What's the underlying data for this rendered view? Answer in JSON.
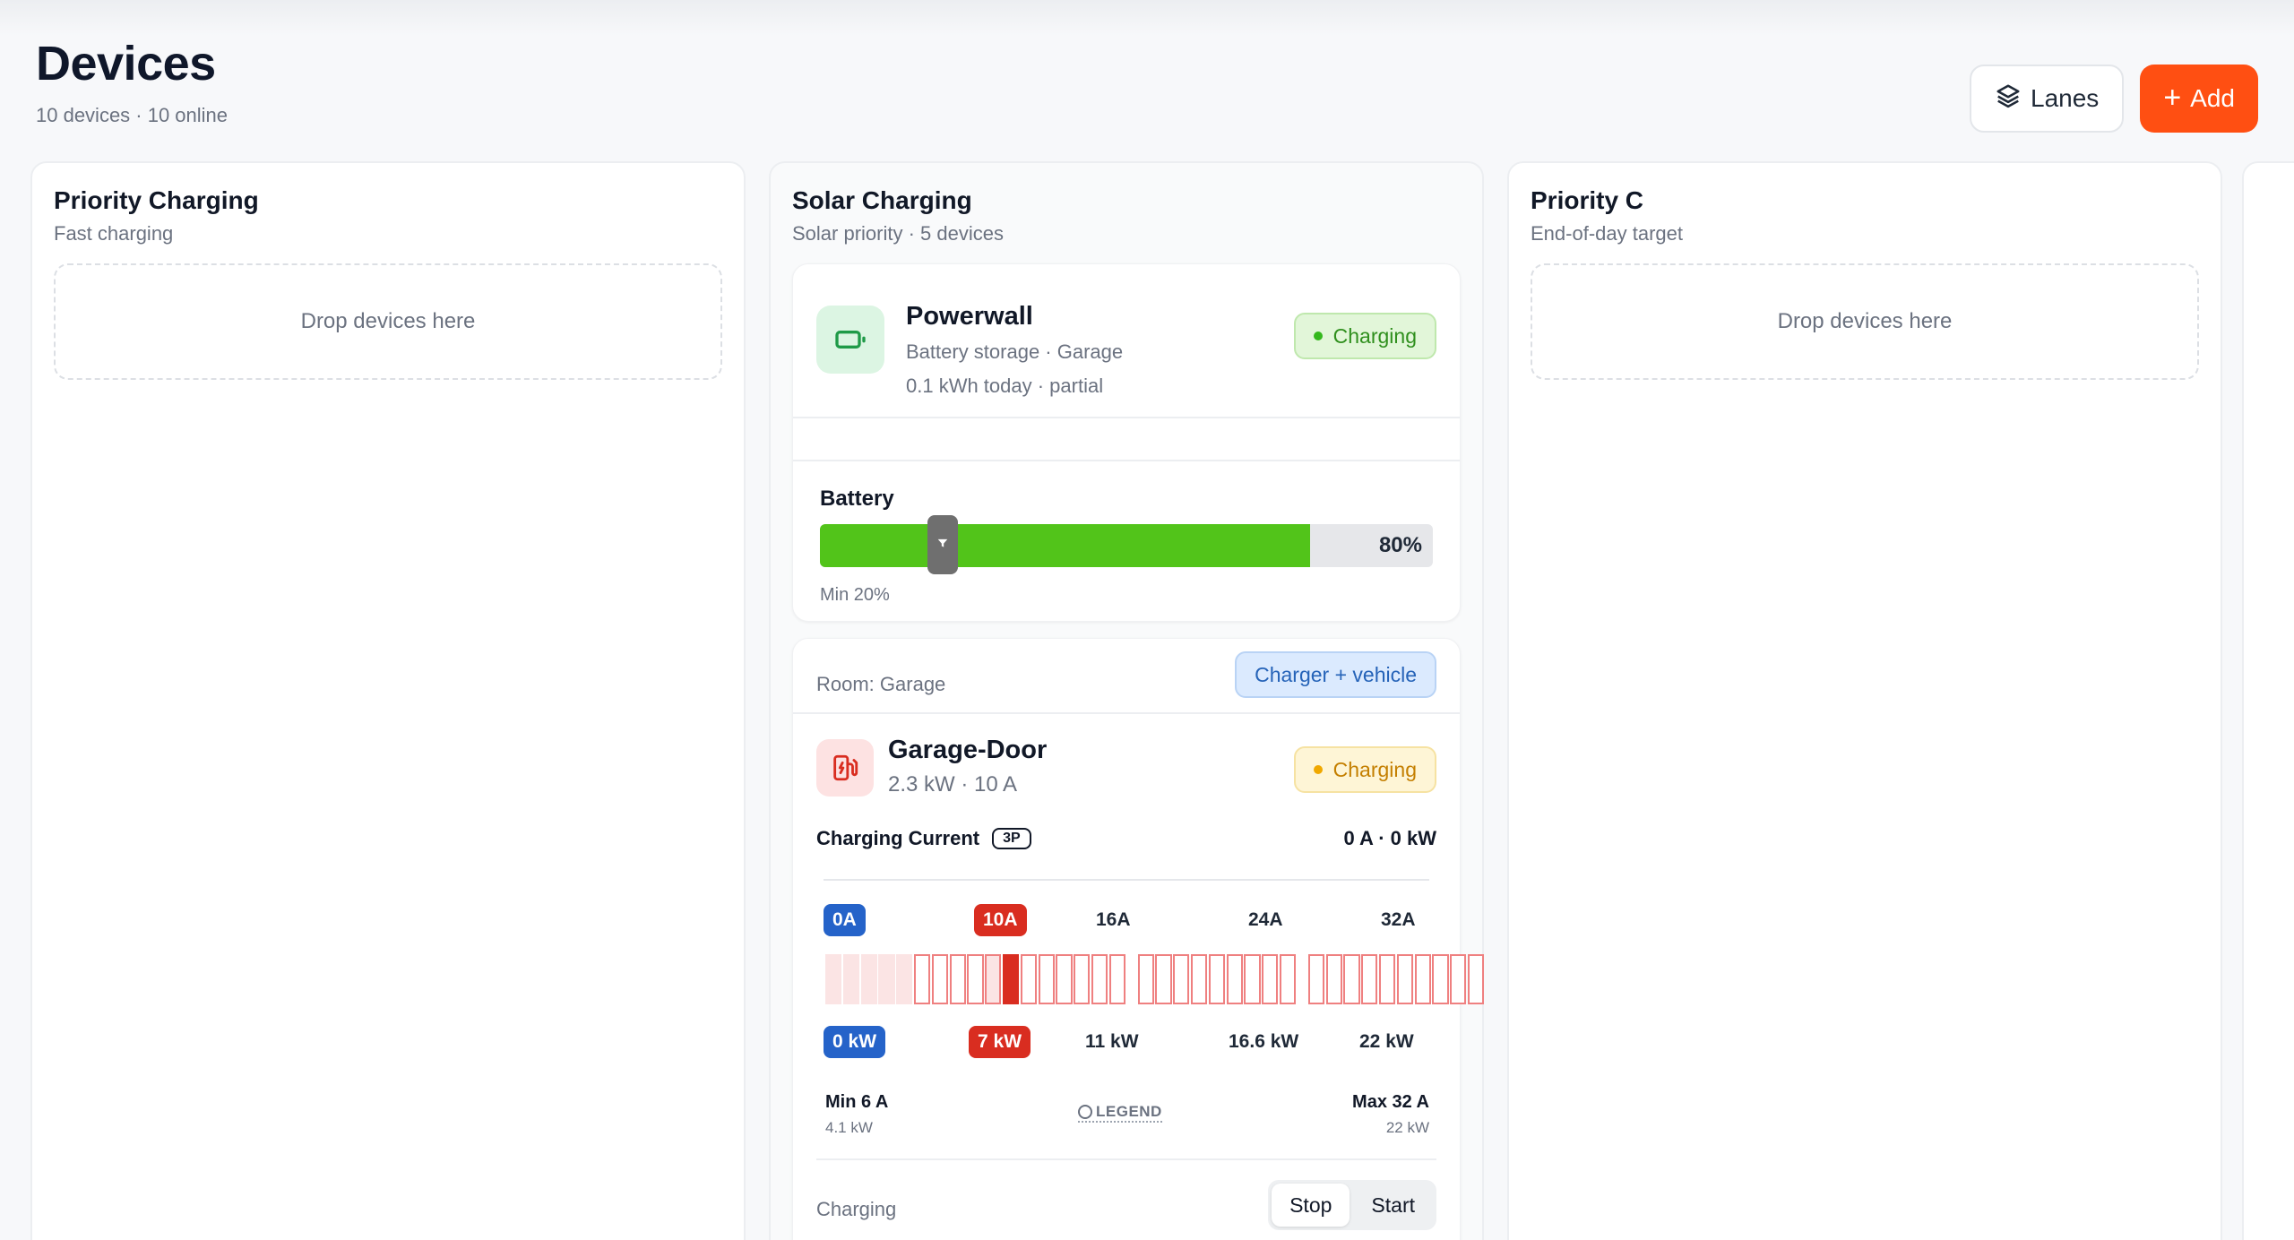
{
  "page": {
    "title": "Devices",
    "subtitle": "10 devices · 10 online"
  },
  "actions": {
    "lanes_label": "Lanes",
    "add_label": "Add"
  },
  "lanes": [
    {
      "title": "Priority Charging",
      "subtitle": "Fast charging",
      "drop_text": "Drop devices here"
    },
    {
      "title": "Solar Charging",
      "subtitle": "Solar priority · 5 devices"
    },
    {
      "title": "Priority C",
      "subtitle": "End-of-day target",
      "drop_text": "Drop devices here"
    }
  ],
  "powerwall": {
    "name": "Powerwall",
    "meta1": "Battery storage · Garage",
    "meta2": "0.1 kWh today · partial",
    "status": "Charging",
    "battery_label": "Battery",
    "battery_level": 0.8,
    "battery_pct_text": "80%",
    "min_fraction": 0.2,
    "min_text": "Min 20%"
  },
  "garage_door": {
    "room": "Room: Garage",
    "chip": "Charger + vehicle",
    "name": "Garage-Door",
    "meta": "2.3 kW · 10 A",
    "status": "Charging",
    "current_title": "Charging Current",
    "phase_tag": "3P",
    "current_value": "0 A · 0 kW",
    "amp_labels": [
      "0A",
      "10A",
      "16A",
      "24A",
      "32A"
    ],
    "kw_labels": [
      "0 kW",
      "7 kW",
      "11 kW",
      "16.6 kW",
      "22 kW"
    ],
    "min_label": "Min 6 A",
    "min_sub": "4.1 kW",
    "max_label": "Max 32 A",
    "max_sub": "22 kW",
    "legend": "LEGEND",
    "selected_amps": 10,
    "charging_label": "Charging",
    "stop_label": "Stop",
    "start_label": "Start"
  },
  "colors": {
    "accent": "#ff4f12",
    "green": "#52c41a",
    "red": "#d92d20",
    "blue": "#2563c9"
  }
}
